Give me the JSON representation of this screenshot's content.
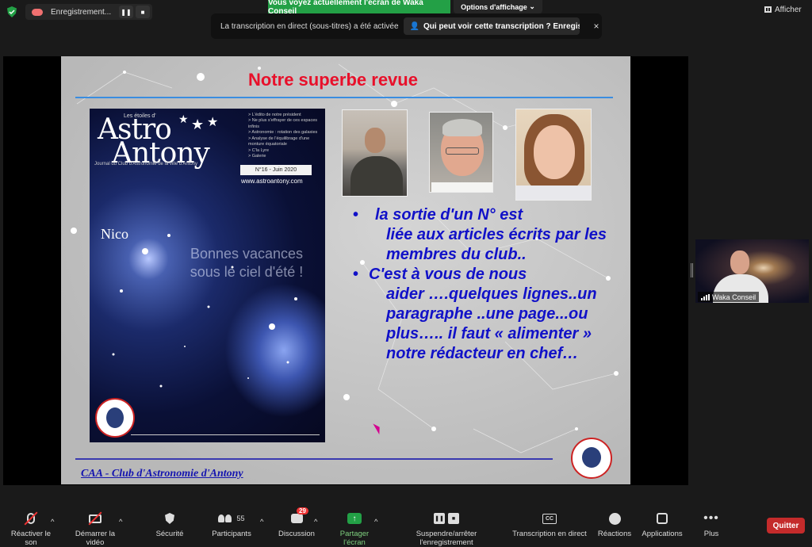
{
  "topbar": {
    "recording_label": "Enregistrement...",
    "pause_icon": "pause-icon",
    "stop_icon": "stop-icon",
    "share_banner": "Vous voyez actuellement l'écran de Waka Conseil",
    "view_options": "Options d'affichage",
    "afficher": "Afficher"
  },
  "transcription": {
    "notice": "La transcription en direct (sous-titres) a été activée",
    "who_can_see": "Qui peut voir cette transcription ? Enregis...",
    "close": "×"
  },
  "slide": {
    "title": "Notre superbe revue",
    "footer": "CAA - Club d'Astronomie d'Antony",
    "magazine": {
      "top_small": "Les étoiles d'",
      "logo_line1": "Astro",
      "logo_line2": "Antony",
      "journal": "Journal du Club d'Astronomie de la ville d'Antony",
      "toc": [
        "> L'édito de notre président",
        "> Ne plus s'effrayer de ces espaces infinis",
        "> Astronomie : rotation des galaxies",
        "> Analyse de l'équilibrage d'une monture équatoriale",
        "> C'la Lyre",
        "> Galerie"
      ],
      "issue": "N°16 - Juin 2020",
      "url": "www.astroantony.com",
      "nico": "Nico",
      "vacances": "Bonnes vacances sous le ciel d'été !"
    },
    "bullet1_first": "la sortie d'un N° est",
    "bullet1_rest": "liée aux articles écrits par les membres du club..",
    "bullet2_first": "C'est à vous de nous",
    "bullet2_rest": "aider ….quelques lignes..un paragraphe ..une page...ou plus….. il faut « alimenter » notre rédacteur en chef…"
  },
  "selfview": {
    "name": "Waka Conseil"
  },
  "toolbar": {
    "mute": "Réactiver le son",
    "video": "Démarrer la vidéo",
    "security": "Sécurité",
    "participants": "Participants",
    "participants_count": "55",
    "chat": "Discussion",
    "chat_badge": "29",
    "share": "Partager l'écran",
    "recording": "Suspendre/arrêter l'enregistrement",
    "transcription": "Transcription en direct",
    "cc": "CC",
    "reactions": "Réactions",
    "apps": "Applications",
    "more": "Plus",
    "quit": "Quitter"
  },
  "colors": {
    "title_red": "#e8102a",
    "bullet_blue": "#1111c8",
    "share_green": "#23a046",
    "quit_red": "#c42b2b"
  }
}
